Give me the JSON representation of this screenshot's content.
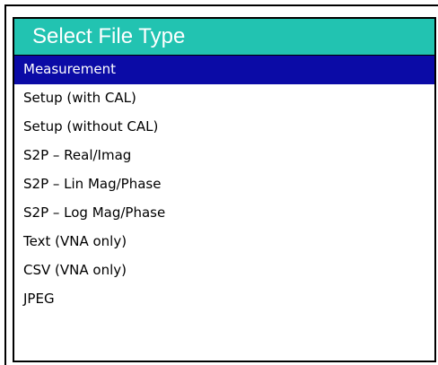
{
  "dialog": {
    "title": "Select File Type"
  },
  "file_types": {
    "selected_index": 0,
    "items": [
      {
        "label": "Measurement"
      },
      {
        "label": "Setup (with CAL)"
      },
      {
        "label": "Setup (without CAL)"
      },
      {
        "label": "S2P – Real/Imag"
      },
      {
        "label": "S2P – Lin Mag/Phase"
      },
      {
        "label": "S2P – Log Mag/Phase"
      },
      {
        "label": "Text (VNA only)"
      },
      {
        "label": "CSV (VNA only)"
      },
      {
        "label": "JPEG"
      }
    ]
  },
  "colors": {
    "title_bar": "#22c3b1",
    "title_text": "#ffffff",
    "selection_bg": "#0b0ba6",
    "selection_text": "#ffffff"
  }
}
